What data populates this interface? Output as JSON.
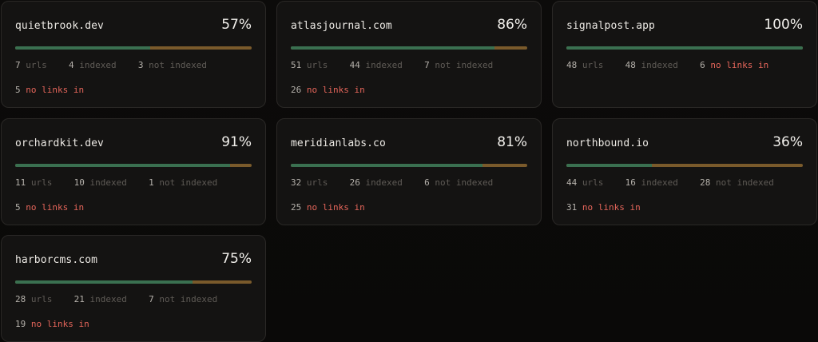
{
  "cards": [
    {
      "site": "quietbrook.dev",
      "percent_label": "57%",
      "percent": 0.57,
      "urls": "7",
      "urls_label": "urls",
      "indexed": "4",
      "indexed_label": "indexed",
      "not_indexed": "3",
      "not_indexed_label": "not indexed",
      "no_links": "5",
      "no_links_label": "no links in"
    },
    {
      "site": "atlasjournal.com",
      "percent_label": "86%",
      "percent": 0.86,
      "urls": "51",
      "urls_label": "urls",
      "indexed": "44",
      "indexed_label": "indexed",
      "not_indexed": "7",
      "not_indexed_label": "not indexed",
      "no_links": "26",
      "no_links_label": "no links in"
    },
    {
      "site": "signalpost.app",
      "percent_label": "100%",
      "percent": 1.0,
      "urls": "48",
      "urls_label": "urls",
      "indexed": "48",
      "indexed_label": "indexed",
      "not_indexed": "",
      "not_indexed_label": "",
      "no_links": "6",
      "no_links_label": "no links in"
    },
    {
      "site": "orchardkit.dev",
      "percent_label": "91%",
      "percent": 0.91,
      "urls": "11",
      "urls_label": "urls",
      "indexed": "10",
      "indexed_label": "indexed",
      "not_indexed": "1",
      "not_indexed_label": "not indexed",
      "no_links": "5",
      "no_links_label": "no links in"
    },
    {
      "site": "meridianlabs.co",
      "percent_label": "81%",
      "percent": 0.81,
      "urls": "32",
      "urls_label": "urls",
      "indexed": "26",
      "indexed_label": "indexed",
      "not_indexed": "6",
      "not_indexed_label": "not indexed",
      "no_links": "25",
      "no_links_label": "no links in"
    },
    {
      "site": "northbound.io",
      "percent_label": "36%",
      "percent": 0.36,
      "urls": "44",
      "urls_label": "urls",
      "indexed": "16",
      "indexed_label": "indexed",
      "not_indexed": "28",
      "not_indexed_label": "not indexed",
      "no_links": "31",
      "no_links_label": "no links in"
    },
    {
      "site": "harborcms.com",
      "percent_label": "75%",
      "percent": 0.75,
      "urls": "28",
      "urls_label": "urls",
      "indexed": "21",
      "indexed_label": "indexed",
      "not_indexed": "7",
      "not_indexed_label": "not indexed",
      "no_links": "19",
      "no_links_label": "no links in"
    }
  ],
  "colors": {
    "indexed_bar": "#3a7050",
    "not_indexed_bar": "#7a5a2b",
    "warning_text": "#e4655a"
  }
}
